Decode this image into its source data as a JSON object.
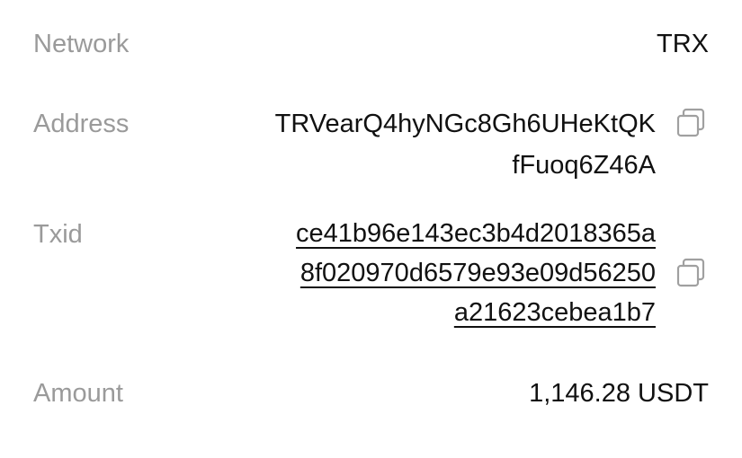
{
  "network": {
    "label": "Network",
    "value": "TRX"
  },
  "address": {
    "label": "Address",
    "lines": [
      "TRVearQ4hyNGc8Gh6UHeKtQK",
      "fFuoq6Z46A"
    ]
  },
  "txid": {
    "label": "Txid",
    "lines": [
      "ce41b96e143ec3b4d2018365a",
      "8f020970d6579e93e09d56250",
      "a21623cebea1b7"
    ]
  },
  "amount": {
    "label": "Amount",
    "value": "1,146.28 USDT"
  },
  "icons": {
    "copy": "copy-icon"
  },
  "colors": {
    "label": "#9a9a9a",
    "value": "#111111",
    "icon": "#a0a0a0"
  }
}
